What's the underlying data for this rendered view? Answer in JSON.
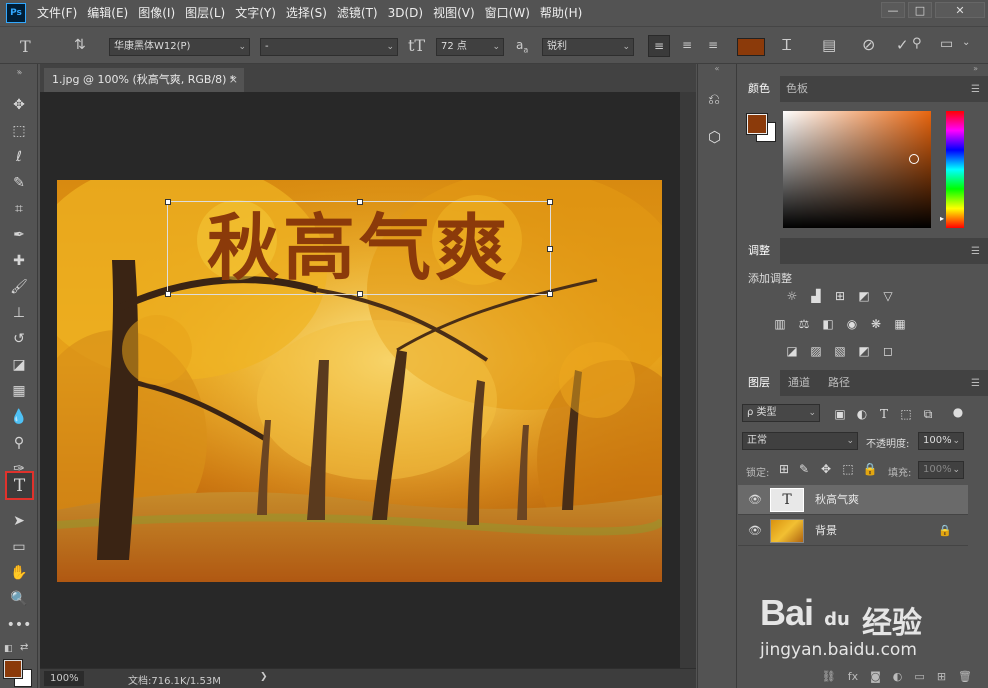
{
  "app": {
    "logo": "Ps"
  },
  "menu": [
    "文件(F)",
    "编辑(E)",
    "图像(I)",
    "图层(L)",
    "文字(Y)",
    "选择(S)",
    "滤镜(T)",
    "3D(D)",
    "视图(V)",
    "窗口(W)",
    "帮助(H)"
  ],
  "window_controls": {
    "minimize": "—",
    "maximize": "□",
    "close": "✕"
  },
  "options": {
    "font_family": "华康黑体W12(P)",
    "font_style": "-",
    "font_size": "72 点",
    "aa_label": "a",
    "aa_sub": "a",
    "antialias": "锐利",
    "text_color": "#8b3a0a"
  },
  "document": {
    "tab_title": "1.jpg @ 100% (秋高气爽, RGB/8) *",
    "close": "×",
    "text_layer": "秋高气爽"
  },
  "status": {
    "zoom": "100%",
    "doc_info": "文档:716.1K/1.53M",
    "arrow": "❯"
  },
  "colors": {
    "foreground": "#8b3a0a",
    "background": "#ffffff",
    "accent": "#e0322c"
  },
  "panels": {
    "color_tabs": [
      "颜色",
      "色板"
    ],
    "adjust_tab": "调整",
    "adjust_title": "添加调整",
    "layers_tabs": [
      "图层",
      "通道",
      "路径"
    ],
    "layer_filter": "ρ 类型",
    "blend_mode": "正常",
    "opacity_label": "不透明度:",
    "opacity_value": "100%",
    "lock_label": "锁定:",
    "fill_label": "填充:",
    "fill_value": "100%",
    "layers": [
      {
        "name": "秋高气爽",
        "type": "text",
        "thumb": "T"
      },
      {
        "name": "背景",
        "type": "image"
      }
    ]
  },
  "watermark": {
    "brand": "Bai",
    "paw": "du",
    "suffix": "经验",
    "url": "jingyan.baidu.com"
  }
}
